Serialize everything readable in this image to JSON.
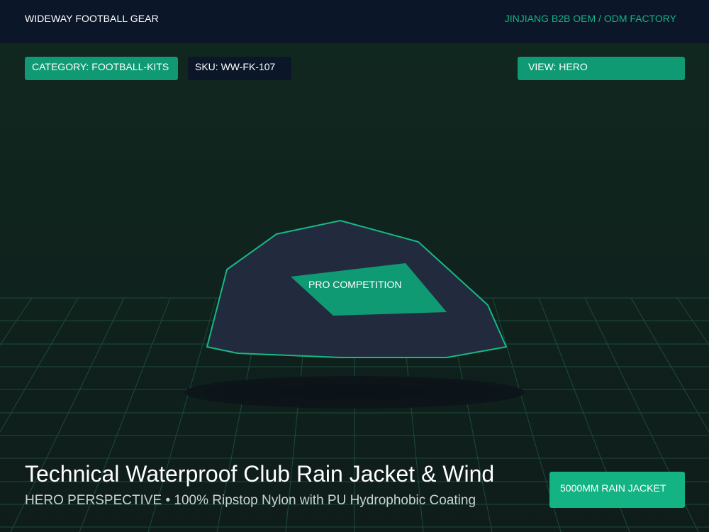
{
  "header": {
    "brand": "WIDEWAY FOOTBALL GEAR",
    "factory": "JINJIANG B2B OEM / ODM FACTORY"
  },
  "tags": {
    "category": "CATEGORY: FOOTBALL-KITS",
    "sku": "SKU: WW-FK-107",
    "view": "VIEW: HERO"
  },
  "product": {
    "patch_label": "PRO COMPETITION",
    "title": "Technical Waterproof Club Rain Jacket & Wind",
    "subtitle": "HERO PERSPECTIVE • 100% Ripstop Nylon with PU Hydrophobic Coating",
    "badge": "5000MM RAIN JACKET"
  },
  "colors": {
    "background": "#0f1f1a",
    "header_bg": "#0b1729",
    "accent": "#0f9a73",
    "accent_bright": "#14b383",
    "product_body": "#222b3d",
    "grid_line": "#1d4a3b"
  }
}
